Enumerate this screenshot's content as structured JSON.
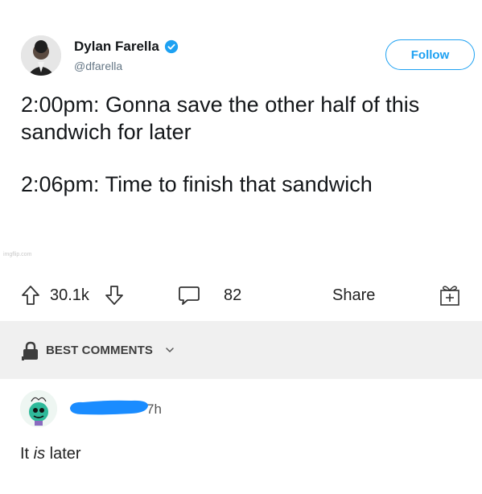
{
  "tweet": {
    "author_name": "Dylan Farella",
    "handle": "@dfarella",
    "follow_label": "Follow",
    "line1": "2:00pm: Gonna save the other half of this sandwich for later",
    "line2": "2:06pm: Time to finish that sandwich",
    "watermark": "imgflip.com",
    "accent_color": "#1da1f2"
  },
  "actions": {
    "score": "30.1k",
    "comment_count": "82",
    "share_label": "Share",
    "icons": [
      "arrow-up-icon",
      "arrow-down-icon",
      "comment-bubble-icon",
      "gift-icon"
    ]
  },
  "comments_header": {
    "label": "BEST COMMENTS",
    "icon": "lock-icon"
  },
  "comment": {
    "time": "7h",
    "text_before": "It ",
    "text_emphasis": "is",
    "text_after": " later"
  }
}
